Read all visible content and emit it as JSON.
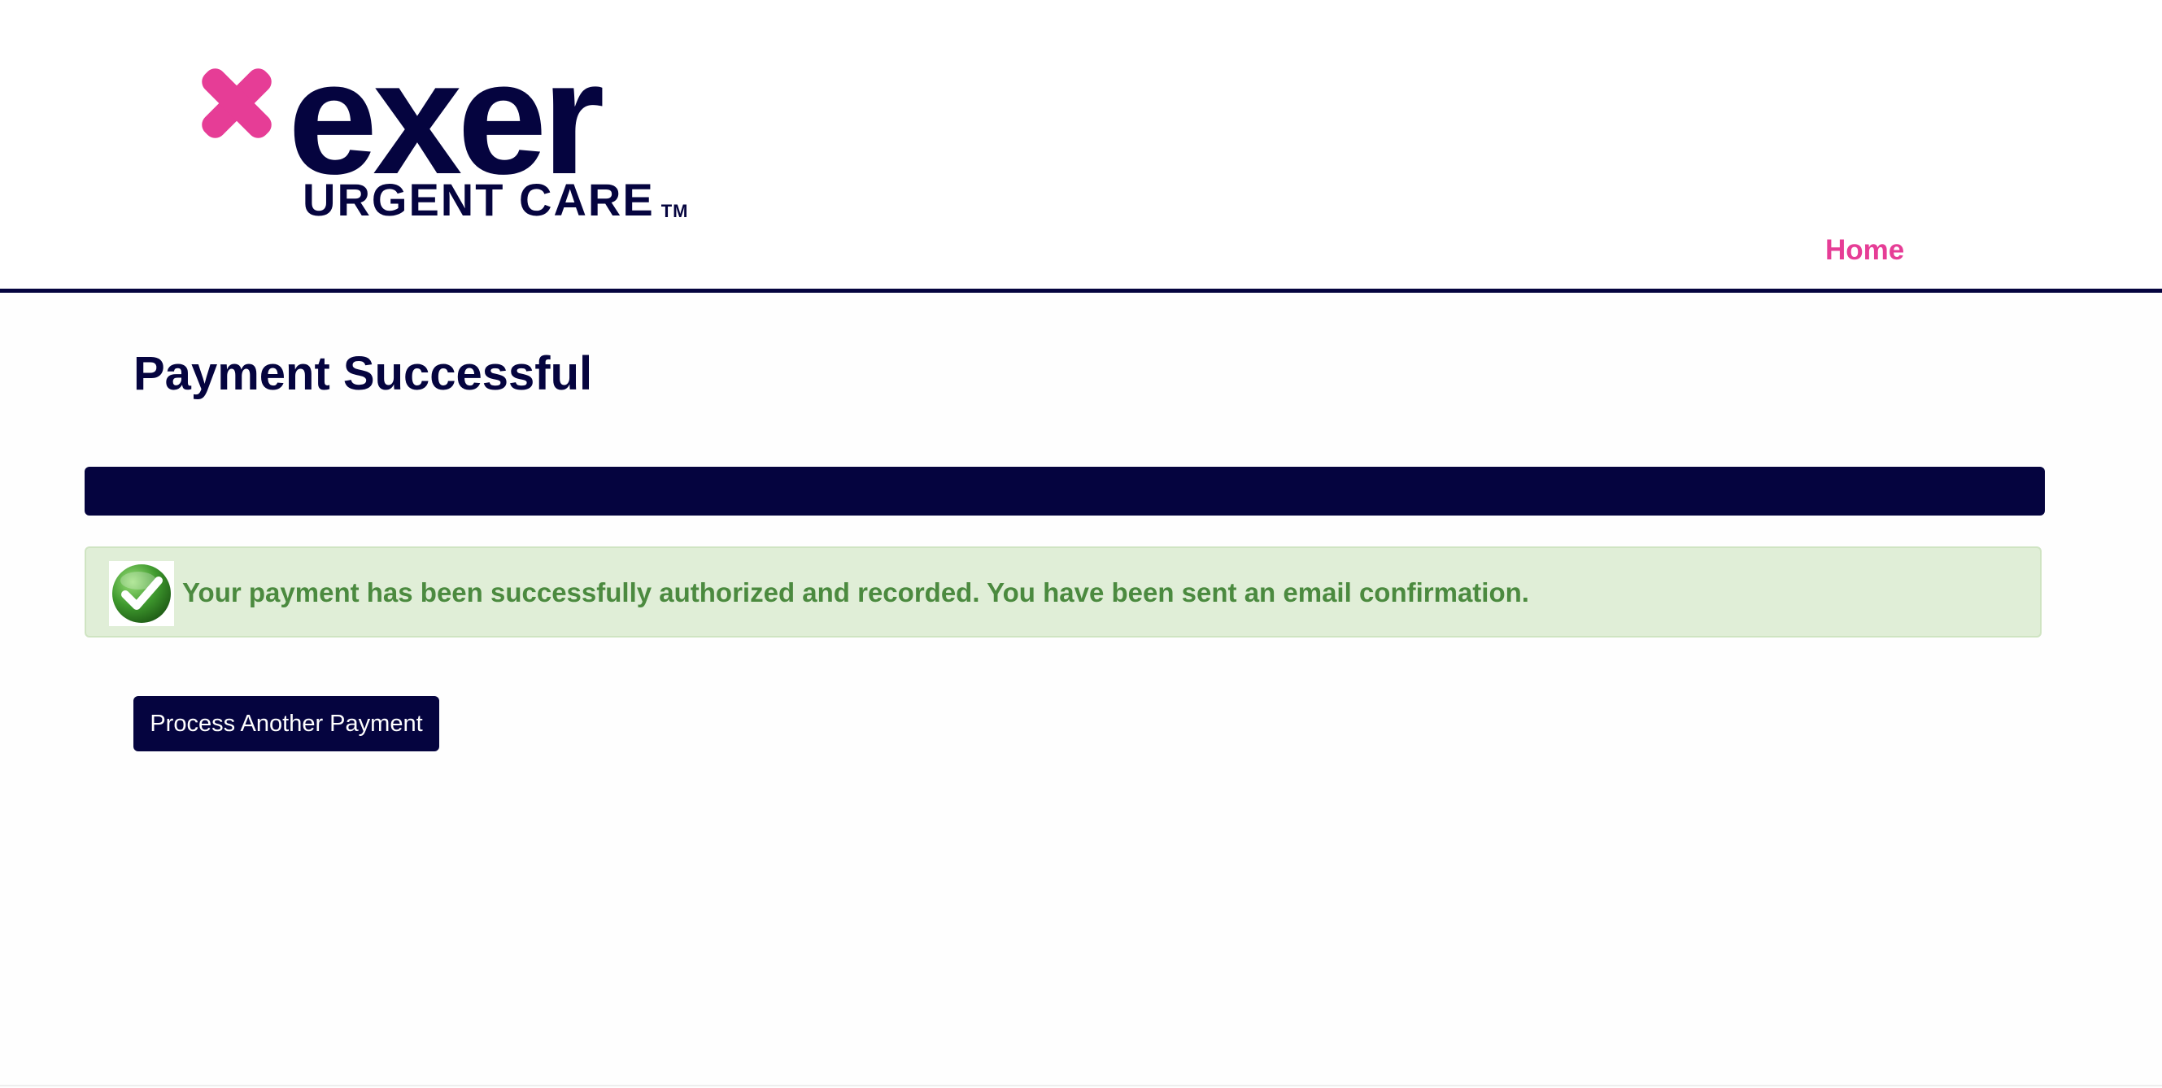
{
  "brand": {
    "name": "exer",
    "subtitle": "URGENT CARE",
    "trademark": "TM",
    "primary_color": "#05043f",
    "accent_color": "#e63d96"
  },
  "nav": {
    "home_label": "Home"
  },
  "main": {
    "title": "Payment Successful",
    "alert": {
      "icon": "check-icon",
      "message": "Your payment has been successfully authorized and recorded. You have been sent an email confirmation.",
      "text_color": "#4b8a3f",
      "background_color": "#e0eed7"
    },
    "process_button_label": "Process Another Payment"
  }
}
